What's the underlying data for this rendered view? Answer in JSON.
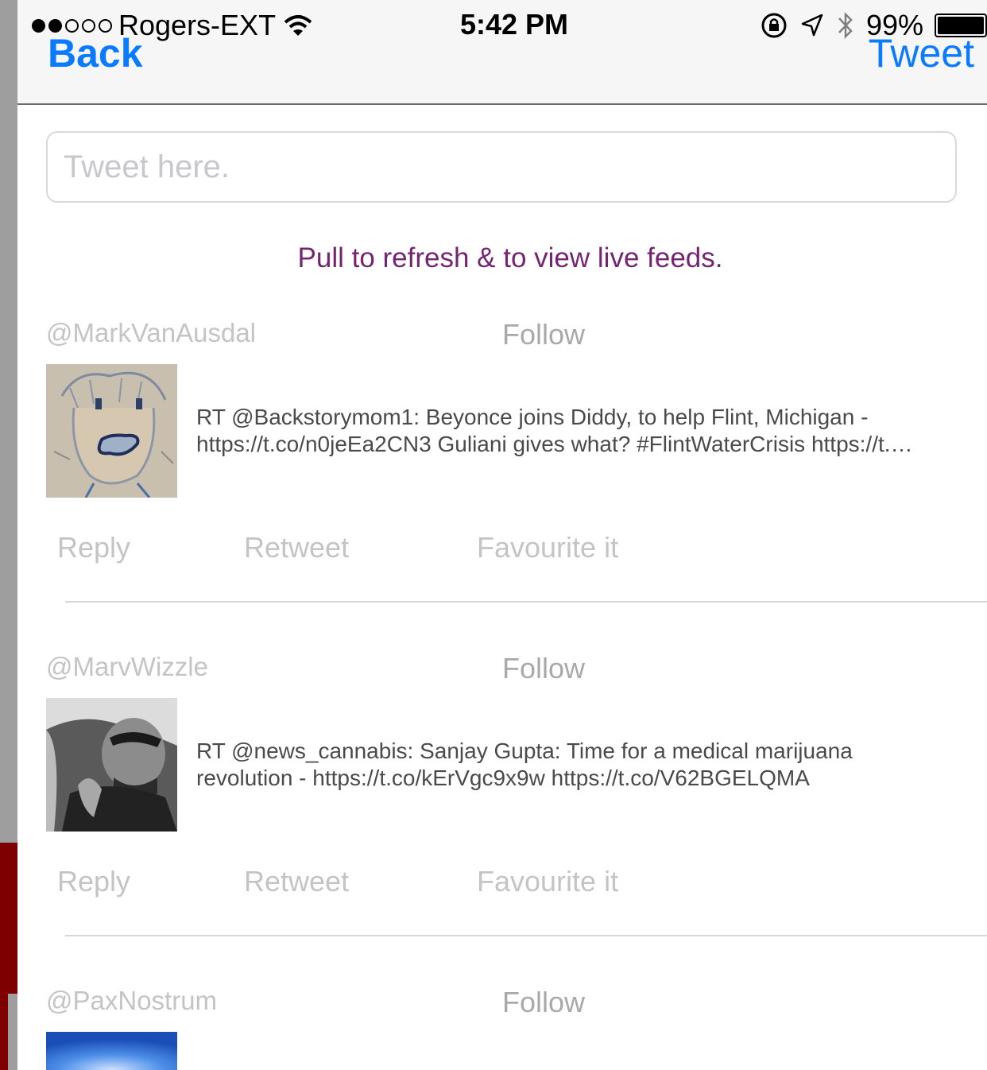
{
  "status_bar": {
    "carrier": "Rogers-EXT",
    "time": "5:42 PM",
    "battery": "99%",
    "icons": [
      "signal-dots-icon",
      "wifi-icon",
      "orientation-lock-icon",
      "location-arrow-icon",
      "bluetooth-icon",
      "battery-icon"
    ]
  },
  "nav": {
    "back_label": "Back",
    "tweet_label": "Tweet"
  },
  "compose": {
    "placeholder": "Tweet here.",
    "value": ""
  },
  "hint": "Pull to refresh & to view live feeds.",
  "colors": {
    "accent": "#0a7aff",
    "hint": "#742470",
    "muted": "#c4c4c4",
    "tweet_text": "#4a4a4a"
  },
  "feed": [
    {
      "handle": "@MarkVanAusdal",
      "follow_label": "Follow",
      "text_line1": "RT @Backstorymom1: Beyonce joins Diddy, to help Flint, Michigan -",
      "text_line2": "https://t.co/n0jeEa2CN3 Guliani gives what? #FlintWaterCrisis  https://t.…",
      "actions": {
        "reply": "Reply",
        "retweet": "Retweet",
        "favourite": "Favourite it"
      }
    },
    {
      "handle": "@MarvWizzle",
      "follow_label": "Follow",
      "text_line1": "RT @news_cannabis: Sanjay Gupta: Time for a medical marijuana",
      "text_line2": "revolution - https://t.co/kErVgc9x9w https://t.co/V62BGELQMA",
      "actions": {
        "reply": "Reply",
        "retweet": "Retweet",
        "favourite": "Favourite it"
      }
    },
    {
      "handle": "@PaxNostrum",
      "follow_label": "Follow"
    }
  ]
}
